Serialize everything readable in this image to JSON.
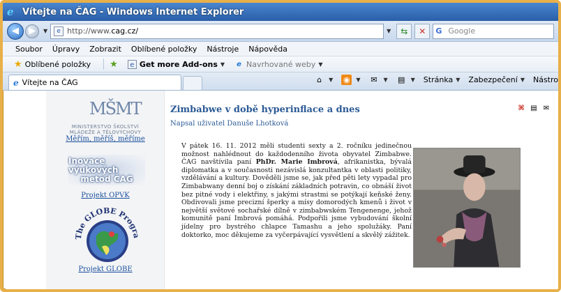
{
  "window": {
    "title": "Vítejte na ČAG - Windows Internet Explorer"
  },
  "address_bar": {
    "url_prefix": "http://www.",
    "url_host": "cag.cz/",
    "search_placeholder": "Google"
  },
  "menu": {
    "items": [
      "Soubor",
      "Úpravy",
      "Zobrazit",
      "Oblíbené položky",
      "Nástroje",
      "Nápověda"
    ]
  },
  "favorites_bar": {
    "favorites_label": "Oblíbené položky",
    "addons_label": "Get more Add-ons",
    "suggested_label": "Navrhované weby"
  },
  "tabs": [
    {
      "label": "Vítejte na ČAG"
    }
  ],
  "command_bar": {
    "page_label": "Stránka",
    "security_label": "Zabezpečení",
    "tools_label": "Nástro"
  },
  "sidebar": {
    "logo_letters": "MŠMT",
    "ministry_line1": "MINISTERSTVO ŠKOLSTVÍ",
    "ministry_line2": "MLÁDEŽE A TĚLOVÝCHOVY",
    "ministry_link": "Měřím, měříš, měříme",
    "opvk_line1": "Inovace výukových",
    "opvk_line2": "metod ČAG",
    "opvk_link": "Projekt OPVK",
    "globe_caption": "The GLOBE Program",
    "globe_link": "Projekt GLOBE"
  },
  "article": {
    "title": "Zimbabwe v době hyperinflace a dnes",
    "author": "Napsal uživatel Danuše Lhotková",
    "body_part1": "V pátek 16. 11. 2012 měli studenti sexty a 2. ročníku jedinečnou možnost nahlédnout do každodenního života obyvatel Zimbabwe. ČAG navštívila paní ",
    "body_bold": "PhDr. Marie Imbrová",
    "body_part2": ", afrikanistka, bývalá diplomatka a v současnosti nezávislá konzultantka v oblasti politiky, vzdělávání a kultury. Dověděli jsme se, jak před pěti lety vypadal pro Zimbabwany denní boj o získání základních potravin, co obnáší život bez pitné vody i elektřiny, s jakými strastmi se potýkají keňské ženy. Obdivovali jsme precizní šperky a mísy domorodých kmenů i život v největší světové sochařské dílně v zimbabwském Tengenenge, jehož komunitě paní Imbrová pomáhá. Podpořili jsme vybudování školní jídelny pro bystrého chlapce Tamashu a jeho spolužáky. Paní doktorko, moc děkujeme za vyčerpávající vysvětlení a skvělý zážitek."
  },
  "colors": {
    "link": "#1a4f9c",
    "heading": "#2b5a96",
    "frame": "#e8b04a"
  }
}
